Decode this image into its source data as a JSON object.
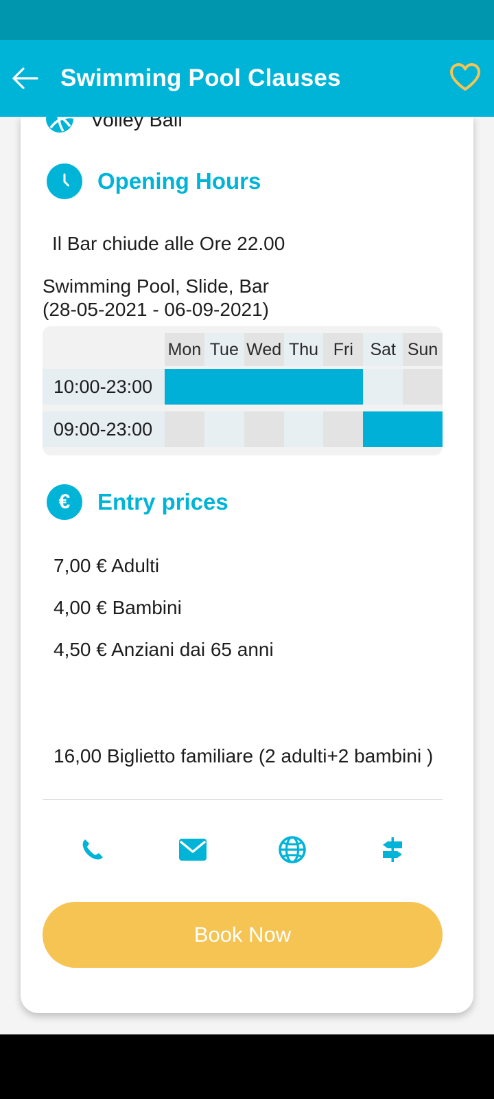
{
  "app_bar": {
    "title": "Swimming Pool Clauses",
    "back_icon": "arrow-left-icon",
    "favorite_icon": "heart-outline-icon",
    "background_color": "#00b4d8",
    "status_bar_color": "#0096ad",
    "favorite_color": "#f6c453"
  },
  "amenity_clipped": {
    "label": "Volley Ball",
    "icon": "volleyball-icon"
  },
  "opening_hours": {
    "icon": "clock-icon",
    "title": "Opening Hours",
    "bar_note": "Il Bar chiude alle Ore 22.00",
    "period_text": "Swimming Pool, Slide, Bar\n(28-05-2021  -  06-09-2021)"
  },
  "schedule": {
    "days": [
      "Mon",
      "Tue",
      "Wed",
      "Thu",
      "Fri",
      "Sat",
      "Sun"
    ],
    "rows": [
      {
        "time": "10:00-23:00",
        "open_days": [
          "Mon",
          "Tue",
          "Wed",
          "Thu",
          "Fri"
        ]
      },
      {
        "time": "09:00-23:00",
        "open_days": [
          "Sat",
          "Sun"
        ]
      }
    ],
    "open_color": "#00b0d7",
    "shade_a_color": "#e3e3e3",
    "shade_b_color": "#e8eff2",
    "time_cell_color": "#e6eef1",
    "panel_color": "#f2f2f2"
  },
  "entry_prices": {
    "icon": "euro-icon",
    "title": "Entry prices",
    "items": [
      "7,00 € Adulti",
      "4,00 € Bambini",
      "4,50 € Anziani dai 65 anni"
    ],
    "family_ticket": "16,00 Biglietto familiare (2 adulti+2 bambini )"
  },
  "contact_actions": [
    {
      "icon": "phone-icon",
      "name": "call"
    },
    {
      "icon": "email-icon",
      "name": "email"
    },
    {
      "icon": "globe-icon",
      "name": "website"
    },
    {
      "icon": "signpost-icon",
      "name": "directions"
    }
  ],
  "book": {
    "label": "Book Now",
    "color": "#f6c453"
  }
}
